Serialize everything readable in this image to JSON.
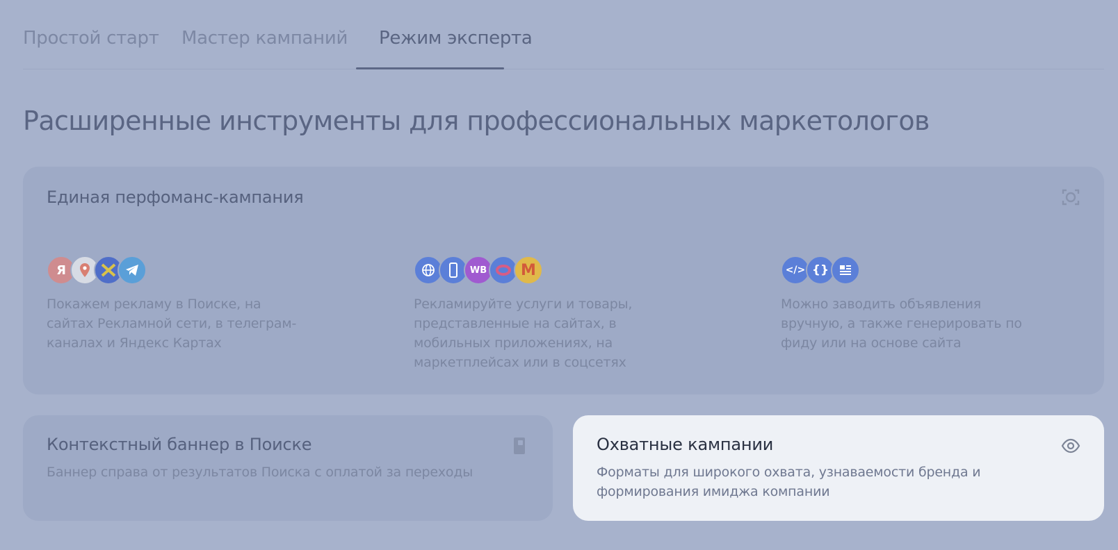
{
  "tabs": [
    {
      "label": "Простой старт"
    },
    {
      "label": "Мастер кампаний"
    },
    {
      "label": "Режим эксперта"
    }
  ],
  "page_title": "Расширенные инструменты для профессиональных маркетологов",
  "perf_card": {
    "title": "Единая перфоманс-кампания",
    "columns": [
      {
        "icons": [
          "yandex-icon",
          "maps-pin-icon",
          "network-icon",
          "telegram-icon"
        ],
        "text": "Покажем рекламу в Поиске, на сайтах Рекламной сети, в телеграм-каналах и Яндекс Картах"
      },
      {
        "icons": [
          "globe-icon",
          "phone-icon",
          "wildberries-icon",
          "ozon-icon",
          "market-icon"
        ],
        "text": "Рекламируйте услуги и товары, представленные на сайтах, в мобильных приложениях, на маркетплейсах или в соцсетях"
      },
      {
        "icons": [
          "code-icon",
          "braces-icon",
          "feed-icon"
        ],
        "text": "Можно заводить объявления вручную, а также генерировать по фиду или на основе сайта"
      }
    ]
  },
  "ctx_card": {
    "title": "Контекстный баннер в Поиске",
    "text": "Баннер справа от результатов Поиска с оплатой за переходы"
  },
  "reach_card": {
    "title": "Охватные кампании",
    "text": "Форматы для широкого охвата, узнаваемости бренда и формирования имиджа компании"
  },
  "colors": {
    "overlay": "#a7b2cc",
    "card": "#9eaac6",
    "highlight_card": "#eef1f6",
    "yandex": "#d98a8a",
    "blue": "#5a7fd6",
    "purple": "#9a6bd1"
  }
}
